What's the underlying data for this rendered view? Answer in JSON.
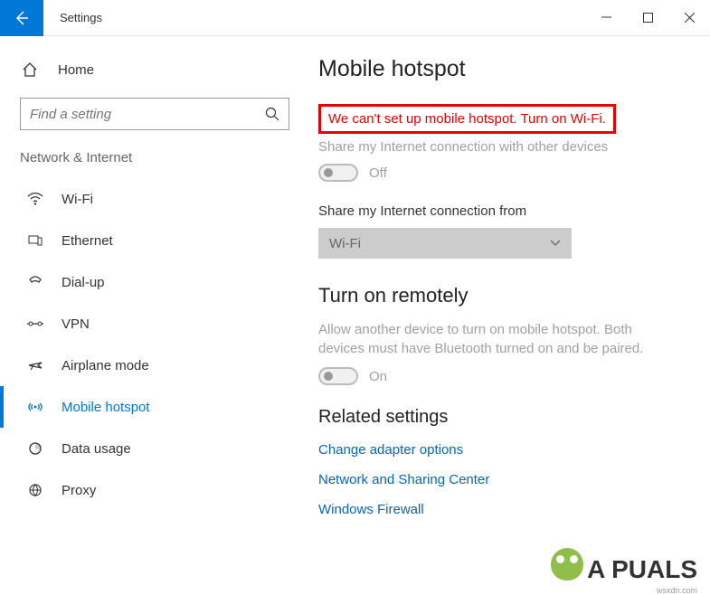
{
  "titlebar": {
    "title": "Settings"
  },
  "sidebar": {
    "home": "Home",
    "search_placeholder": "Find a setting",
    "section": "Network & Internet",
    "items": [
      {
        "label": "Wi-Fi",
        "icon": "wifi"
      },
      {
        "label": "Ethernet",
        "icon": "ethernet"
      },
      {
        "label": "Dial-up",
        "icon": "dialup"
      },
      {
        "label": "VPN",
        "icon": "vpn"
      },
      {
        "label": "Airplane mode",
        "icon": "airplane"
      },
      {
        "label": "Mobile hotspot",
        "icon": "hotspot",
        "active": true
      },
      {
        "label": "Data usage",
        "icon": "data"
      },
      {
        "label": "Proxy",
        "icon": "proxy"
      }
    ]
  },
  "main": {
    "heading": "Mobile hotspot",
    "error": "We can't set up mobile hotspot. Turn on Wi-Fi.",
    "share_label": "Share my Internet connection with other devices",
    "toggle1_state": "Off",
    "share_from_label": "Share my Internet connection from",
    "share_from_value": "Wi-Fi",
    "remote_heading": "Turn on remotely",
    "remote_desc": "Allow another device to turn on mobile hotspot. Both devices must have Bluetooth turned on and be paired.",
    "toggle2_state": "On",
    "related_heading": "Related settings",
    "links": [
      "Change adapter options",
      "Network and Sharing Center",
      "Windows Firewall"
    ]
  },
  "watermark": {
    "text": "A PUALS",
    "sub": "wsxdn.com"
  }
}
